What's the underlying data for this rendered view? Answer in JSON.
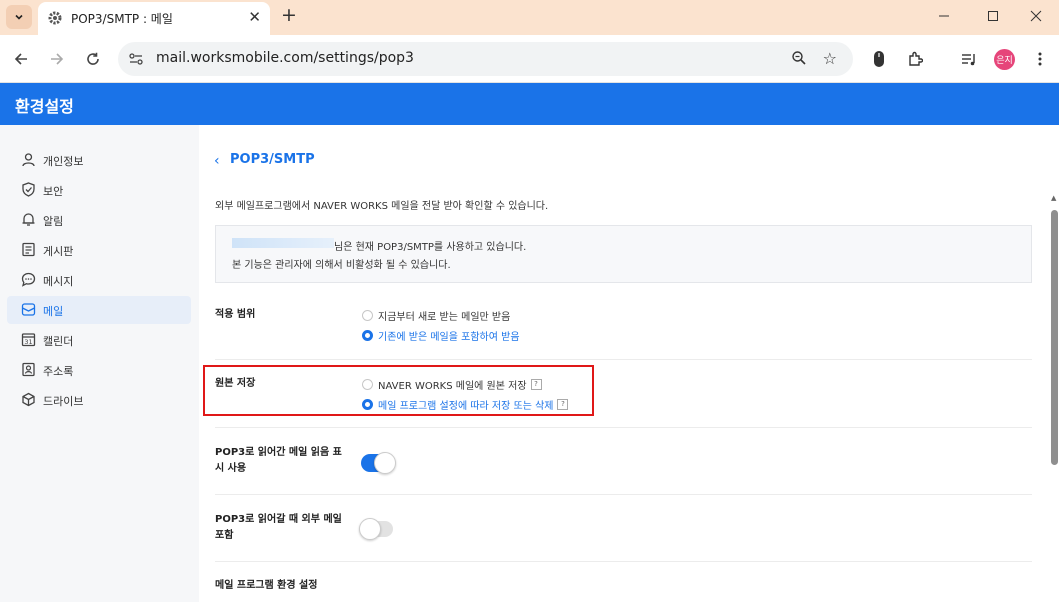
{
  "browser": {
    "tab_title": "POP3/SMTP : 메일",
    "url": "mail.worksmobile.com/settings/pop3",
    "avatar_text": "은지"
  },
  "app": {
    "title": "환경설정"
  },
  "sidebar": {
    "items": [
      {
        "label": "개인정보",
        "icon": "person-icon",
        "active": false
      },
      {
        "label": "보안",
        "icon": "shield-icon",
        "active": false
      },
      {
        "label": "알림",
        "icon": "bell-icon",
        "active": false
      },
      {
        "label": "게시판",
        "icon": "board-icon",
        "active": false
      },
      {
        "label": "메시지",
        "icon": "chat-icon",
        "active": false
      },
      {
        "label": "메일",
        "icon": "mail-icon",
        "active": true
      },
      {
        "label": "캘린더",
        "icon": "calendar-icon",
        "active": false
      },
      {
        "label": "주소록",
        "icon": "contacts-icon",
        "active": false
      },
      {
        "label": "드라이브",
        "icon": "drive-icon",
        "active": false
      }
    ],
    "calendar_day": "31"
  },
  "main": {
    "page_title": "POP3/SMTP",
    "description": "외부 메일프로그램에서 NAVER WORKS 메일을 전달 받아 확인할 수 있습니다.",
    "notice_line1": "님은 현재 POP3/SMTP를 사용하고 있습니다.",
    "notice_line2": "본 기능은 관리자에 의해서 비활성화 될 수 있습니다.",
    "scope": {
      "label": "적용 범위",
      "option1": "지금부터 새로 받는 메일만 받음",
      "option2": "기존에 받은 메일을 포함하여 받음",
      "selected": 2
    },
    "original": {
      "label": "원본 저장",
      "option1": "NAVER WORKS 메일에 원본 저장",
      "option2": "메일 프로그램 설정에 따라 저장 또는 삭제",
      "selected": 2,
      "help": "?"
    },
    "read_mark": {
      "label": "POP3로 읽어간 메일 읽음 표시 사용",
      "enabled": true
    },
    "external": {
      "label": "POP3로 읽어갈 때 외부 메일 포함",
      "enabled": false
    },
    "program_settings": {
      "label": "메일 프로그램 환경 설정"
    }
  },
  "colors": {
    "accent": "#1a73e8",
    "highlight": "#e01818",
    "tabstrip": "#fbe3cf"
  }
}
